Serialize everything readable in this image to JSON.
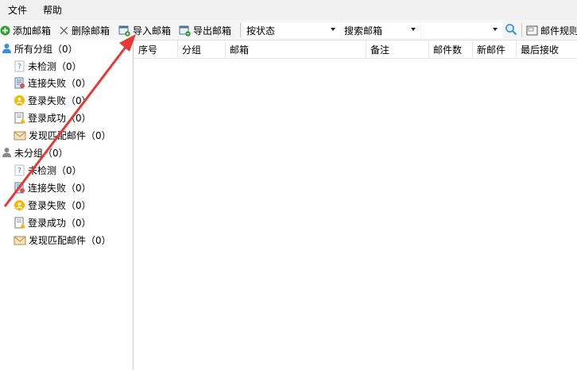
{
  "menu": {
    "file": "文件",
    "help": "帮助"
  },
  "toolbar": {
    "add_mailbox": "添加邮箱",
    "delete_mailbox": "删除邮箱",
    "import_mailbox": "导入邮箱",
    "export_mailbox": "导出邮箱",
    "status_filter": "按状态",
    "search_field": "搜索邮箱",
    "search_input_value": "",
    "mail_rules": "邮件规则"
  },
  "tree": {
    "all_groups": {
      "label": "所有分组（0）",
      "children": [
        {
          "label": "未检测（0）"
        },
        {
          "label": "连接失败（0）"
        },
        {
          "label": "登录失败（0）"
        },
        {
          "label": "登录成功（0）"
        },
        {
          "label": "发现匹配邮件（0）"
        }
      ]
    },
    "ungrouped": {
      "label": "未分组（0）",
      "children": [
        {
          "label": "未检测（0）"
        },
        {
          "label": "连接失败（0）"
        },
        {
          "label": "登录失败（0）"
        },
        {
          "label": "登录成功（0）"
        },
        {
          "label": "发现匹配邮件（0）"
        }
      ]
    }
  },
  "grid": {
    "columns": [
      "序号",
      "分组",
      "邮箱",
      "备注",
      "邮件数",
      "新邮件",
      "最后接收"
    ]
  },
  "colors": {
    "annotation_arrow": "#e53935",
    "add_icon": "#2e9e2e",
    "user_icon": "#3a8fd9"
  }
}
